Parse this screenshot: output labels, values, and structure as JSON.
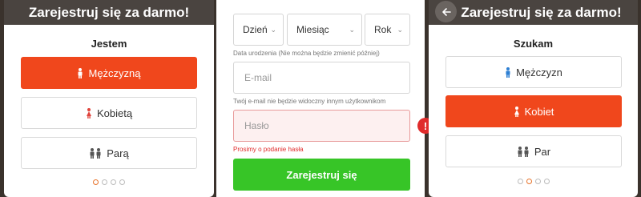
{
  "colors": {
    "accent": "#f0471c",
    "submit": "#37c527",
    "header": "#4a4440",
    "error": "#e02b2b",
    "male_icon": "#2d7fd3",
    "female_icon": "#e0433b"
  },
  "panel_left": {
    "header_title": "Zarejestruj się za darmo!",
    "heading": "Jestem",
    "options": [
      {
        "label": "Mężczyzną",
        "icon": "male-icon",
        "selected": true
      },
      {
        "label": "Kobietą",
        "icon": "female-icon",
        "selected": false
      },
      {
        "label": "Parą",
        "icon": "couple-icon",
        "selected": false
      }
    ],
    "pagination": {
      "total": 4,
      "current": 1
    }
  },
  "panel_middle": {
    "date": {
      "day_label": "Dzień",
      "month_label": "Miesiąc",
      "year_label": "Rok",
      "hint": "Data urodzenia (Nie można będzie zmienić później)"
    },
    "email": {
      "placeholder": "E-mail",
      "hint": "Twój e-mail nie będzie widoczny innym użytkownikom"
    },
    "password": {
      "placeholder": "Hasło",
      "error": "Prosimy o podanie hasła",
      "warning_symbol": "!"
    },
    "submit_label": "Zarejestruj się"
  },
  "panel_right": {
    "header_title": "Zarejestruj się za darmo!",
    "back_icon": "arrow-left-icon",
    "heading": "Szukam",
    "options": [
      {
        "label": "Mężczyzn",
        "icon": "male-icon",
        "selected": false
      },
      {
        "label": "Kobiet",
        "icon": "female-icon",
        "selected": true
      },
      {
        "label": "Par",
        "icon": "couple-icon",
        "selected": false
      }
    ],
    "pagination": {
      "total": 4,
      "current": 2
    }
  }
}
